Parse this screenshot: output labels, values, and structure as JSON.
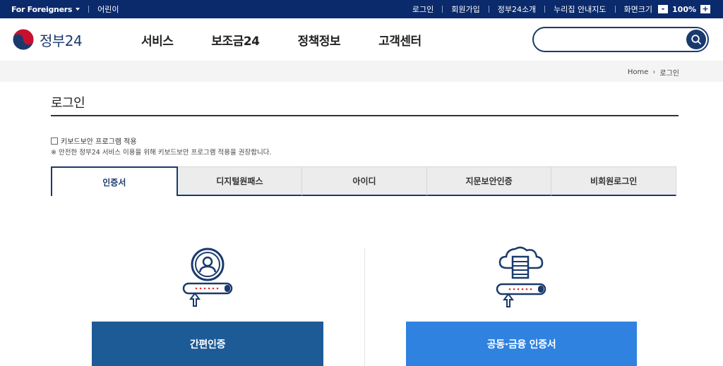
{
  "topbar": {
    "language": "For Foreigners",
    "kids": "어린이",
    "links": [
      "로그인",
      "회원가입",
      "정부24소개",
      "누리집 안내지도"
    ],
    "zoom_label": "화면크기",
    "zoom_minus": "-",
    "zoom_value": "100%",
    "zoom_plus": "+"
  },
  "header": {
    "logo": "정부24",
    "nav": [
      "서비스",
      "보조금24",
      "정책정보",
      "고객센터"
    ],
    "search": {
      "placeholder": "",
      "value": ""
    }
  },
  "breadcrumb": {
    "home": "Home",
    "current": "로그인"
  },
  "page": {
    "title": "로그인",
    "keyboard_security_label": "키보드보안 프로그램 적용",
    "keyboard_security_checked": false,
    "notice": "※ 안전한 정부24 서비스 이용을 위해 키보드보안 프로그램 적용을 권장합니다."
  },
  "tabs": {
    "items": [
      "인증서",
      "디지털원패스",
      "아이디",
      "지문보안인증",
      "비회원로그인"
    ],
    "active_index": 0
  },
  "login_options": {
    "simple_auth": "간편인증",
    "joint_cert": "공동·금융 인증서"
  },
  "colors": {
    "topbar": "#0b2a6b",
    "primary": "#1a3a6d",
    "simple_btn": "#1d5b96",
    "joint_btn": "#2f82e0",
    "password_dots": "#e03030"
  }
}
